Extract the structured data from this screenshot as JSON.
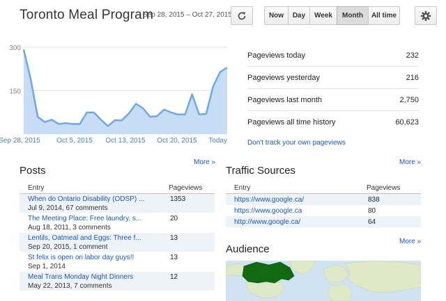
{
  "header": {
    "title": "Toronto Meal Program",
    "date_range": "Sep 28, 2015 – Oct 27, 2015",
    "refresh_icon": "refresh-icon",
    "ranges": [
      "Now",
      "Day",
      "Week",
      "Month",
      "All time"
    ],
    "active_range": "Month",
    "settings_icon": "gear-icon"
  },
  "chart_data": {
    "type": "area",
    "x_tick_labels": [
      "Sep 28, 2015",
      "Oct 5, 2015",
      "Oct 13, 2015",
      "Oct 20, 2015",
      "Today"
    ],
    "y_tick_labels": [
      "300",
      "150"
    ],
    "ylim": [
      0,
      300
    ],
    "series": [
      {
        "values": [
          292,
          190,
          60,
          42,
          50,
          35,
          38,
          35,
          35,
          75,
          75,
          50,
          28,
          48,
          48,
          72,
          105,
          90,
          60,
          62,
          85,
          75,
          68,
          68,
          138,
          68,
          70,
          165,
          215,
          230
        ]
      }
    ],
    "colors": {
      "line": "#6fa8e8",
      "fill": "#c7dcf5"
    },
    "grid": true
  },
  "stats": {
    "rows": [
      {
        "label": "Pageviews today",
        "value": "232"
      },
      {
        "label": "Pageviews yesterday",
        "value": "216"
      },
      {
        "label": "Pageviews last month",
        "value": "2,750"
      },
      {
        "label": "Pageviews all time history",
        "value": "60,623"
      }
    ],
    "dont_track_link": "Don't track your own pageviews"
  },
  "posts": {
    "more_link": "More »",
    "title": "Posts",
    "columns": [
      "Entry",
      "Pageviews"
    ],
    "rows": [
      {
        "title": "When do Ontario Disability (ODSP) ...",
        "meta": "Jul 9, 2014, 67 comments",
        "views": "1353"
      },
      {
        "title": "The Meeting Place: Free laundry, s...",
        "meta": "Aug 18, 2011, 3 comments",
        "views": "20"
      },
      {
        "title": "Lentils, Oatmeal and Eggs: Three f...",
        "meta": "Sep 20, 2015, 1 comment",
        "views": "13"
      },
      {
        "title": "St felix is open on labor day guys!!",
        "meta": "Sep 1, 2014",
        "views": "13"
      },
      {
        "title": "Meal Trans Monday Night Dinners",
        "meta": "May 22, 2013, 7 comments",
        "views": "12"
      }
    ]
  },
  "traffic": {
    "more_link": "More »",
    "title": "Traffic Sources",
    "columns": [
      "Entry",
      "Pageviews"
    ],
    "rows": [
      {
        "url": "https://www.google.ca/",
        "views": "838"
      },
      {
        "url": "https://www.google.ca",
        "views": "80"
      },
      {
        "url": "http://www.google.ca/",
        "views": "64"
      }
    ]
  },
  "audience": {
    "more_link": "More »",
    "title": "Audience",
    "map_colors": {
      "ocean": "#cfe3f3",
      "land": "#dfe9c8",
      "highlight": "#0f6a12"
    }
  }
}
